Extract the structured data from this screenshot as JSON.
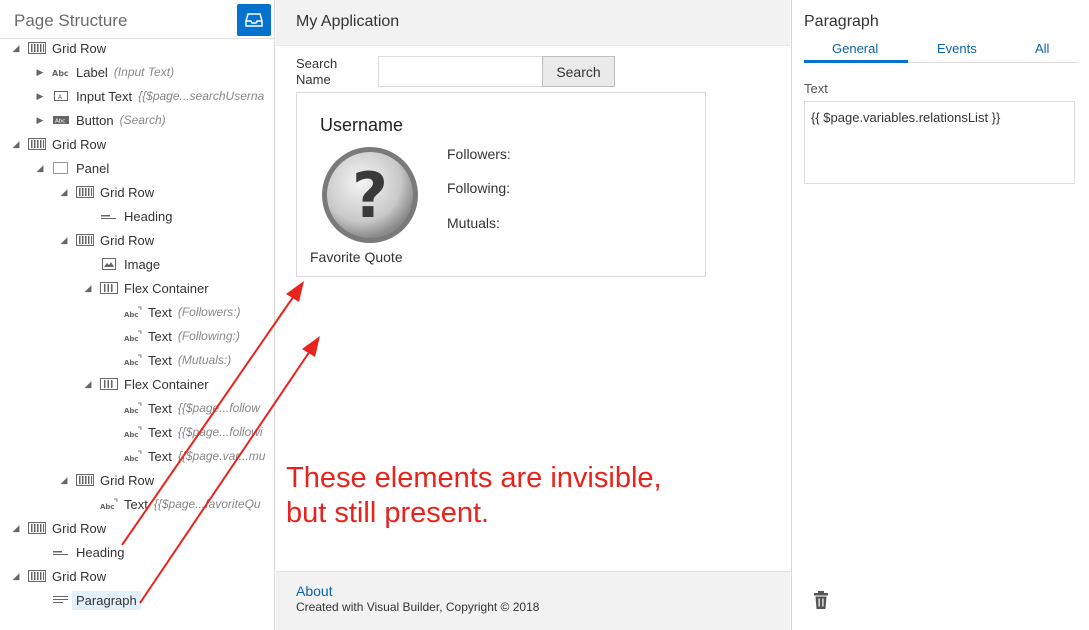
{
  "left_panel": {
    "title": "Page Structure",
    "tree": [
      {
        "label": "Grid Row",
        "sub": "",
        "icon": "grid-row-icon",
        "toggle": "expanded",
        "depth": 0
      },
      {
        "label": "Label",
        "sub": "(Input Text)",
        "icon": "label-icon",
        "toggle": "collapsed",
        "depth": 1
      },
      {
        "label": "Input Text",
        "sub": "{{$page...searchUserna",
        "icon": "input-text-icon",
        "toggle": "collapsed",
        "depth": 1
      },
      {
        "label": "Button",
        "sub": "(Search)",
        "icon": "button-icon",
        "toggle": "collapsed",
        "depth": 1
      },
      {
        "label": "Grid Row",
        "sub": "",
        "icon": "grid-row-icon",
        "toggle": "expanded",
        "depth": 0
      },
      {
        "label": "Panel",
        "sub": "",
        "icon": "panel-icon",
        "toggle": "expanded",
        "depth": 1
      },
      {
        "label": "Grid Row",
        "sub": "",
        "icon": "grid-row-icon",
        "toggle": "expanded",
        "depth": 2
      },
      {
        "label": "Heading",
        "sub": "",
        "icon": "heading-icon",
        "toggle": "none",
        "depth": 3
      },
      {
        "label": "Grid Row",
        "sub": "",
        "icon": "grid-row-icon",
        "toggle": "expanded",
        "depth": 2
      },
      {
        "label": "Image",
        "sub": "",
        "icon": "image-icon",
        "toggle": "none",
        "depth": 3
      },
      {
        "label": "Flex Container",
        "sub": "",
        "icon": "flex-container-icon",
        "toggle": "expanded",
        "depth": 3
      },
      {
        "label": "Text",
        "sub": "(Followers:)",
        "icon": "text-icon",
        "toggle": "none",
        "depth": 4
      },
      {
        "label": "Text",
        "sub": "(Following:)",
        "icon": "text-icon",
        "toggle": "none",
        "depth": 4
      },
      {
        "label": "Text",
        "sub": "(Mutuals:)",
        "icon": "text-icon",
        "toggle": "none",
        "depth": 4
      },
      {
        "label": "Flex Container",
        "sub": "",
        "icon": "flex-container-icon",
        "toggle": "expanded",
        "depth": 3
      },
      {
        "label": "Text",
        "sub": "{{$page...follow",
        "icon": "text-icon",
        "toggle": "none",
        "depth": 4
      },
      {
        "label": "Text",
        "sub": "{{$page...followi",
        "icon": "text-icon",
        "toggle": "none",
        "depth": 4
      },
      {
        "label": "Text",
        "sub": "{{$page.var...mu",
        "icon": "text-icon",
        "toggle": "none",
        "depth": 4
      },
      {
        "label": "Grid Row",
        "sub": "",
        "icon": "grid-row-icon",
        "toggle": "expanded",
        "depth": 2
      },
      {
        "label": "Text",
        "sub": "{{$page...favoriteQu",
        "icon": "text-icon",
        "toggle": "none",
        "depth": 3
      },
      {
        "label": "Grid Row",
        "sub": "",
        "icon": "grid-row-icon",
        "toggle": "expanded",
        "depth": 0
      },
      {
        "label": "Heading",
        "sub": "",
        "icon": "heading-icon",
        "toggle": "none",
        "depth": 1
      },
      {
        "label": "Grid Row",
        "sub": "",
        "icon": "grid-row-icon",
        "toggle": "expanded",
        "depth": 0
      },
      {
        "label": "Paragraph",
        "sub": "",
        "icon": "paragraph-icon",
        "toggle": "none",
        "depth": 1,
        "selected": true
      }
    ]
  },
  "app": {
    "title": "My Application",
    "search": {
      "label": "Search Name",
      "value": "",
      "button": "Search"
    },
    "card": {
      "username": "Username",
      "favorite_quote": "Favorite Quote",
      "followers": "Followers:",
      "following": "Following:",
      "mutuals": "Mutuals:"
    },
    "annotation": "These elements are invisible, but still present.",
    "footer": {
      "about": "About",
      "copyright": "Created with Visual Builder, Copyright © 2018"
    }
  },
  "right_panel": {
    "title": "Paragraph",
    "tabs": [
      "General",
      "Events",
      "All"
    ],
    "active_tab": "General",
    "text_label": "Text",
    "text_value": "{{ $page.variables.relationsList }}"
  },
  "colors": {
    "accent": "#0572ce",
    "annotation": "#e8231b",
    "link": "#0b63b0"
  }
}
